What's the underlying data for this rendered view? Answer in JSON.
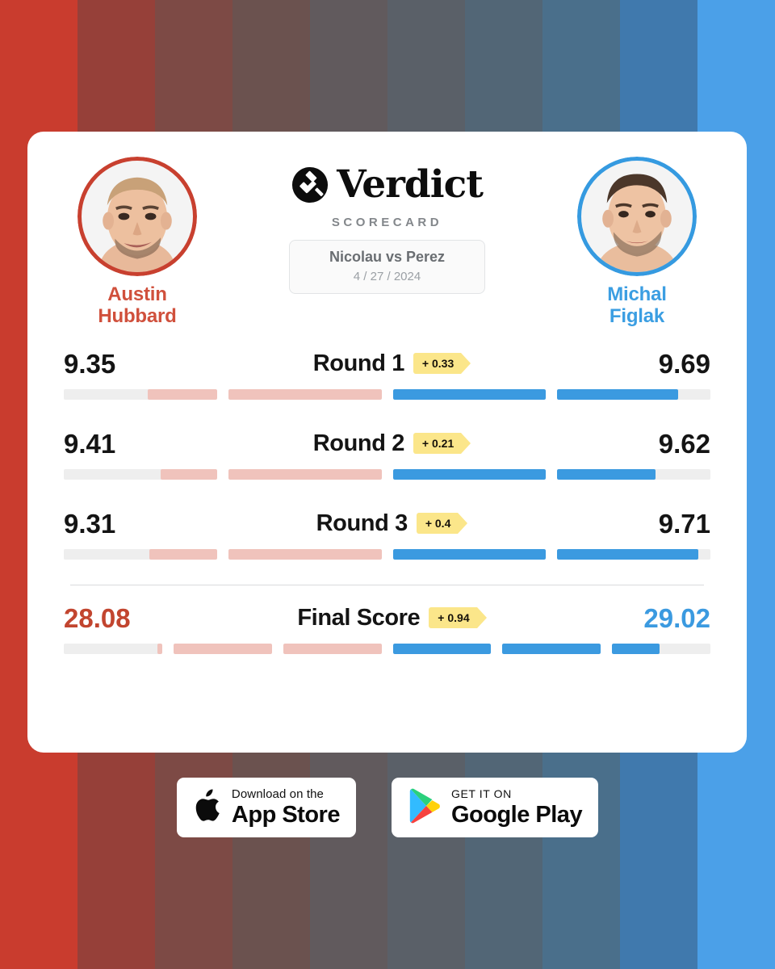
{
  "background": {
    "stripes": [
      "#c93c2e",
      "#964039",
      "#7d4a45",
      "#6b524f",
      "#615a5d",
      "#5a6068",
      "#526676",
      "#4a6f8b",
      "#4079ad",
      "#4ba0e8"
    ]
  },
  "brand": {
    "logo_icon": "gavel-circle-icon",
    "name": "Verdict",
    "subtitle": "SCORECARD",
    "fight_title": "Nicolau vs Perez",
    "fight_date": "4 / 27 / 2024"
  },
  "fighters": {
    "left": {
      "first_name": "Austin",
      "last_name": "Hubbard",
      "color": "#d0503c",
      "avatar_icon": "fighter-portrait-left"
    },
    "right": {
      "first_name": "Michal",
      "last_name": "Figlak",
      "color": "#3b9ee2",
      "avatar_icon": "fighter-portrait-right"
    }
  },
  "chart_data": {
    "type": "bar",
    "title": "Verdict Scorecard — Nicolau vs Perez",
    "categories": [
      "Round 1",
      "Round 2",
      "Round 3",
      "Final Score"
    ],
    "series": [
      {
        "name": "Austin Hubbard",
        "color": "#f0c3bc",
        "values": [
          9.35,
          9.41,
          9.31,
          28.08
        ]
      },
      {
        "name": "Michal Figlak",
        "color": "#3b9ae0",
        "values": [
          9.69,
          9.62,
          9.71,
          29.02
        ]
      }
    ],
    "margins": [
      0.33,
      0.21,
      0.4,
      0.94
    ],
    "margin_direction": [
      "right",
      "right",
      "right",
      "right"
    ],
    "segment_fills": {
      "round1": {
        "left": [
          0.45,
          1.0
        ],
        "right": [
          1.0,
          0.79
        ]
      },
      "round2": {
        "left": [
          0.37,
          1.0
        ],
        "right": [
          1.0,
          0.64
        ]
      },
      "round3": {
        "left": [
          0.44,
          1.0
        ],
        "right": [
          1.0,
          0.92
        ]
      },
      "final": {
        "left": [
          0.05,
          1.0,
          1.0
        ],
        "right": [
          1.0,
          1.0,
          0.48
        ]
      }
    },
    "grid": false,
    "legend": "fighter headshots top-left and top-right"
  },
  "rows": [
    {
      "label": "Round 1",
      "left_score": "9.35",
      "right_score": "9.69",
      "badge": "+ 0.33"
    },
    {
      "label": "Round 2",
      "left_score": "9.41",
      "right_score": "9.62",
      "badge": "+ 0.21"
    },
    {
      "label": "Round 3",
      "left_score": "9.31",
      "right_score": "9.71",
      "badge": "+ 0.4"
    },
    {
      "label": "Final Score",
      "left_score": "28.08",
      "right_score": "29.02",
      "badge": "+ 0.94"
    }
  ],
  "stores": {
    "apple": {
      "icon": "apple-logo-icon",
      "small": "Download on the",
      "big": "App Store"
    },
    "google": {
      "icon": "google-play-icon",
      "small": "GET IT ON",
      "big": "Google Play"
    }
  }
}
